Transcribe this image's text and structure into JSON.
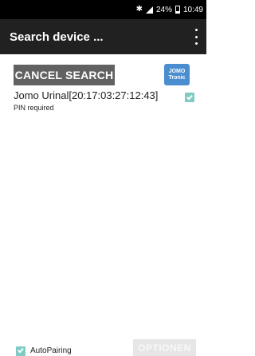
{
  "status_bar": {
    "icons": [
      "bluetooth-icon",
      "signal-icon",
      "battery-icon"
    ],
    "battery": "24%",
    "time": "10:49"
  },
  "app_bar": {
    "title": "Search device ...",
    "menu_icon": "overflow-menu-icon"
  },
  "cancel_button": {
    "label": "CANCEL SEARCH"
  },
  "logo": {
    "line1": "JOMO",
    "line2": "Tronic"
  },
  "devices": [
    {
      "name": "Jomo Urinal[20:17:03:27:12:43]",
      "status": "PIN required",
      "checked": true
    }
  ],
  "footer": {
    "autopairing_label": "AutoPairing",
    "autopairing_checked": true,
    "options_label": "OPTIONEN",
    "options_enabled": false
  },
  "colors": {
    "status_bar": "#000000",
    "app_bar": "#212121",
    "button": "#616161",
    "checkbox": "#80cbc4",
    "logo": "#4a8ed0",
    "disabled_button": "#e6e6e6"
  }
}
